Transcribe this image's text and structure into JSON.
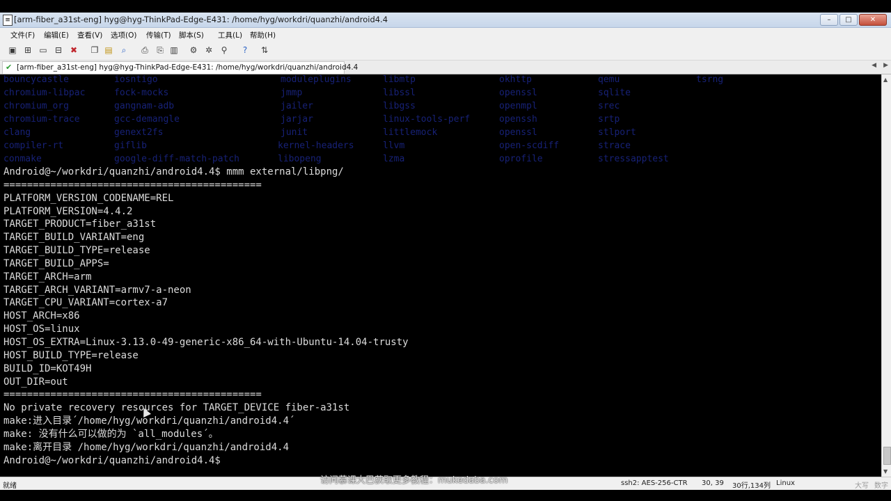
{
  "window": {
    "title": "[arm-fiber_a31st-eng] hyg@hyg-ThinkPad-Edge-E431: /home/hyg/workdri/quanzhi/android4.4",
    "app_icon": "terminal-app-icon",
    "controls": [
      "minimize",
      "maximize",
      "close"
    ]
  },
  "menu": [
    "文件(F)",
    "编辑(E)",
    "查看(V)",
    "选项(O)",
    "传输(T)",
    "脚本(S)",
    "工具(L)",
    "帮助(H)"
  ],
  "toolbar_icons": [
    "new-session-icon",
    "connect-icon",
    "reconnect-icon",
    "disconnect-icon",
    "close-session-icon",
    "copy-icon",
    "paste-icon",
    "find-icon",
    "print-icon",
    "print-setup-icon",
    "printer-icon",
    "session-options-icon",
    "global-options-icon",
    "keymap-icon",
    "help-icon",
    "sftp-icon"
  ],
  "tab": {
    "label": "[arm-fiber_a31st-eng] hyg@hyg-ThinkPad-Edge-E431: /home/hyg/workdri/quanzhi/android4.4",
    "status_icon": "connected-check-icon"
  },
  "terminal": {
    "listing": [
      [
        "bouncycastle",
        "iosntigo",
        "moduleplugins",
        "libmtp",
        "okhttp",
        "qemu",
        "tsrng"
      ],
      [
        "chromium-libpac",
        "fock-mocks",
        "jmmp",
        "libssl",
        "openssl",
        "sqlite",
        ""
      ],
      [
        "chromium_org",
        "gangnam-adb",
        "jailer",
        "libgss",
        "openmpl",
        "srec",
        ""
      ],
      [
        "chromium-trace",
        "gcc-demangle",
        "jarjar",
        "linux-tools-perf",
        "openssh",
        "srtp",
        ""
      ],
      [
        "clang",
        "genext2fs",
        "junit",
        "littlemock",
        "openssl",
        "stlport",
        ""
      ],
      [
        "compiler-rt",
        "giflib",
        "kernel-headers",
        "llvm",
        "open-scdiff",
        "strace",
        ""
      ],
      [
        "conmake",
        "google-diff-match-patch",
        "libopeng",
        "lzma",
        "oprofile",
        "stressapptest",
        ""
      ]
    ],
    "lines": [
      "Android@~/workdri/quanzhi/android4.4$ mmm external/libpng/",
      "============================================",
      "PLATFORM_VERSION_CODENAME=REL",
      "PLATFORM_VERSION=4.4.2",
      "TARGET_PRODUCT=fiber_a31st",
      "TARGET_BUILD_VARIANT=eng",
      "TARGET_BUILD_TYPE=release",
      "TARGET_BUILD_APPS=",
      "TARGET_ARCH=arm",
      "TARGET_ARCH_VARIANT=armv7-a-neon",
      "TARGET_CPU_VARIANT=cortex-a7",
      "HOST_ARCH=x86",
      "HOST_OS=linux",
      "HOST_OS_EXTRA=Linux-3.13.0-49-generic-x86_64-with-Ubuntu-14.04-trusty",
      "HOST_BUILD_TYPE=release",
      "BUILD_ID=KOT49H",
      "OUT_DIR=out",
      "============================================",
      "No private recovery resources for TARGET_DEVICE fiber-a31st",
      "make:进入目录´/home/hyg/workdri/quanzhi/android4.4´",
      "make: 没有什么可以做的为 `all_modules´。",
      "make:离开目录 /home/hyg/workdri/quanzhi/android4.4",
      "Android@~/workdri/quanzhi/android4.4$"
    ]
  },
  "status": {
    "ready": "就绪",
    "encryption": "ssh2: AES-256-CTR",
    "cursor": "30, 39",
    "size": "30行,134列",
    "os": "Linux",
    "caps": "大写",
    "num": "数字"
  },
  "watermark": "访问慕课大巴获取更多教程：mukedaba.com",
  "colors": {
    "terminal_bg": "#000000",
    "terminal_fg": "#dcdcdc",
    "listing_fg": "#1f2d9e",
    "titlebar": "#c7d6ea"
  }
}
